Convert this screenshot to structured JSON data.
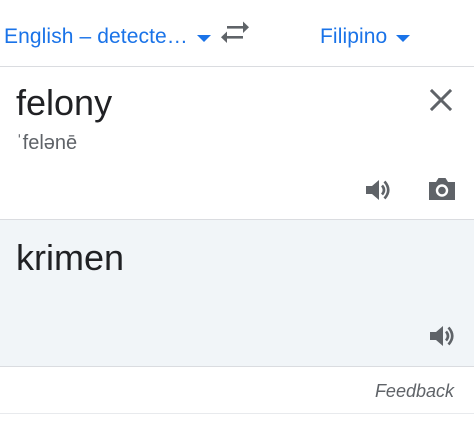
{
  "languages": {
    "source": "English – detecte…",
    "target": "Filipino"
  },
  "icons": {
    "swap": "swap-arrows-icon",
    "clear": "close-icon",
    "speak_source": "speaker-icon",
    "camera": "camera-icon",
    "speak_target": "speaker-icon",
    "dropdown": "caret-down-icon"
  },
  "source": {
    "text": "felony",
    "phonetic": "ˈfelənē"
  },
  "translation": {
    "text": "krimen"
  },
  "footer": {
    "feedback_label": "Feedback"
  },
  "colors": {
    "accent": "#1a73e8",
    "icon": "#5f6368",
    "translation_bg": "#f1f5f8"
  }
}
